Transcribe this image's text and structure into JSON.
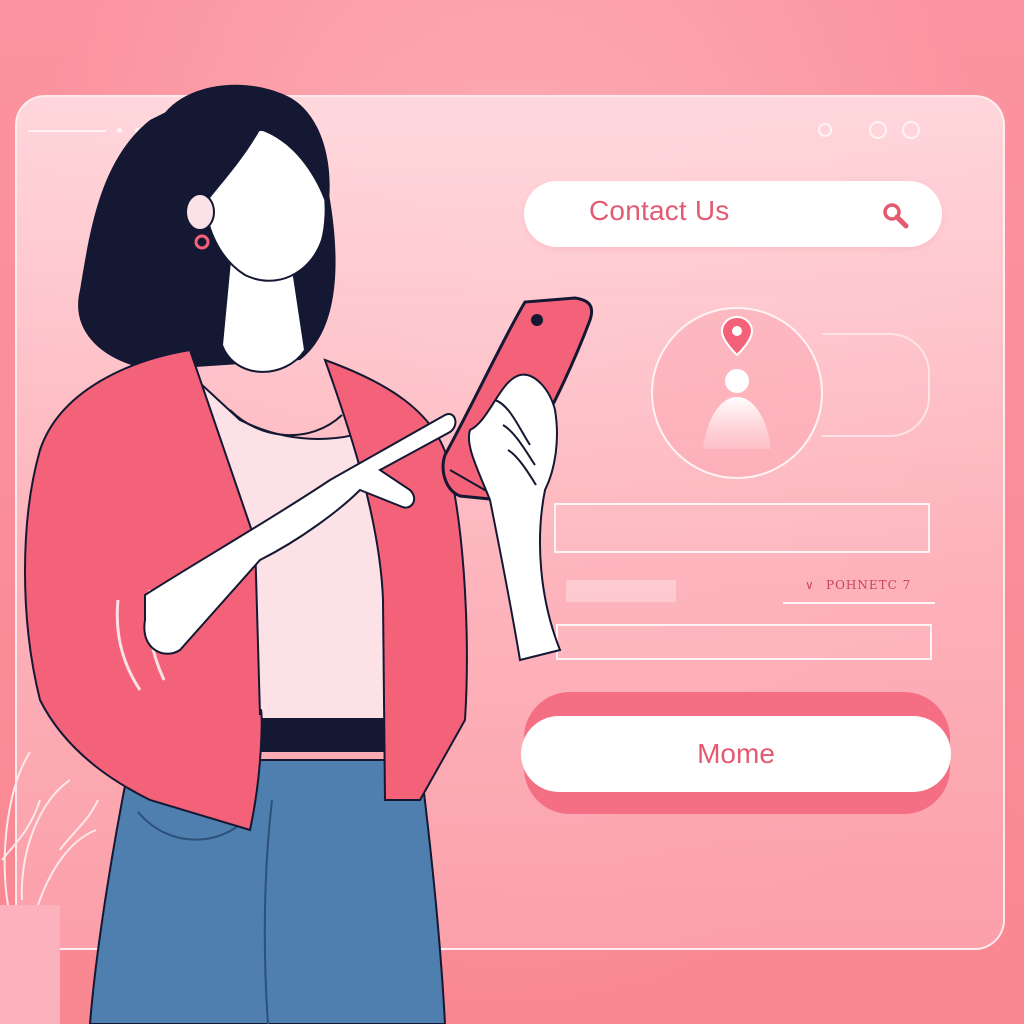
{
  "search": {
    "text": "Contact Us",
    "icon": "search-icon"
  },
  "form": {
    "field_label": "POHNETC 7"
  },
  "main_button": {
    "label": "Mome"
  },
  "colors": {
    "accent": "#e35a71",
    "background": "#f98a96",
    "jacket": "#f4627a",
    "jeans": "#4f7fae",
    "hair": "#141833"
  }
}
